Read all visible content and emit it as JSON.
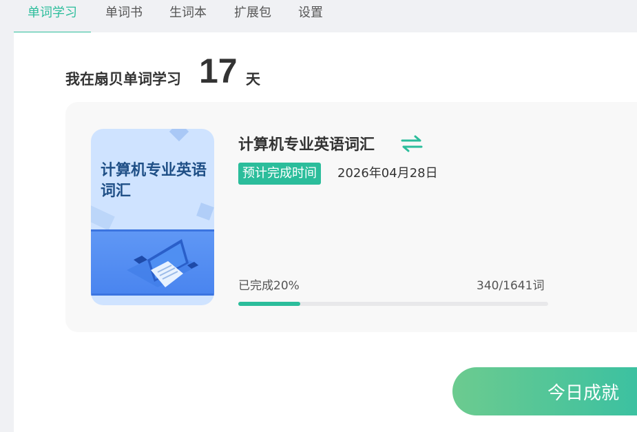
{
  "tabs": [
    {
      "label": "单词学习",
      "active": true
    },
    {
      "label": "单词书",
      "active": false
    },
    {
      "label": "生词本",
      "active": false
    },
    {
      "label": "扩展包",
      "active": false
    },
    {
      "label": "设置",
      "active": false
    }
  ],
  "heading": {
    "prefix": "我在扇贝单词学习",
    "days": "17",
    "suffix": "天"
  },
  "book": {
    "cover_title": "计算机专业英语词汇",
    "title": "计算机专业英语词汇",
    "switch_icon": "swap-arrows-icon",
    "tag_label": "预计完成时间",
    "finish_date": "2026年04月28日",
    "progress_label": "已完成20%",
    "progress_fraction": 0.2,
    "progress_count": "340/1641词"
  },
  "today_button": {
    "label": "今日成就"
  },
  "colors": {
    "accent": "#2bbd9b",
    "background": "#f0f1f4",
    "card": "#f8f8f8"
  }
}
